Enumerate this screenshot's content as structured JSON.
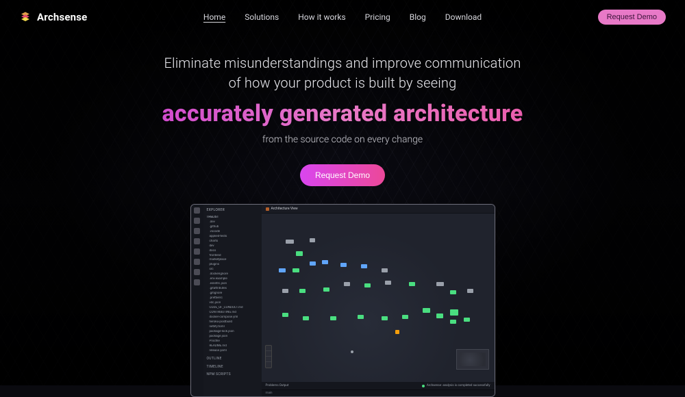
{
  "brand": {
    "name": "Archsense"
  },
  "nav": {
    "links": [
      {
        "label": "Home",
        "active": true
      },
      {
        "label": "Solutions",
        "active": false
      },
      {
        "label": "How it works",
        "active": false
      },
      {
        "label": "Pricing",
        "active": false
      },
      {
        "label": "Blog",
        "active": false
      },
      {
        "label": "Download",
        "active": false
      }
    ],
    "cta": "Request Demo"
  },
  "hero": {
    "lead_line1": "Eliminate misunderstandings and improve communication",
    "lead_line2": "of how your product is built by seeing",
    "title": "accurately generated architecture",
    "sub": "from the source code on every change",
    "cta": "Request Demo"
  },
  "mock": {
    "explorer_title": "EXPLORER",
    "root": "THELIST",
    "tree": [
      ".dev",
      ".github",
      ".vscode",
      "applied-tests",
      "charts",
      "dev",
      "docs",
      "frontend",
      "marketplace",
      "plugins",
      "src",
      ".dockerignore",
      ".env.example",
      ".eslintrc.json",
      ".gitattributes",
      ".gitignore",
      ".prettierrc",
      "vdc.json",
      "CODE_OF_CONDUCT.md",
      "CONTRIBUTING.md",
      "docker-compose.yml",
      "heroku-postbuild",
      "netlify.toml",
      "package-lock.json",
      "package.json",
      "Procfile",
      "README.md",
      "release.yaml"
    ],
    "sections": {
      "outline": "OUTLINE",
      "timeline": "TIMELINE",
      "npm": "NPM SCRIPTS"
    },
    "tab": "Architecture View",
    "status_left": "Problems  Output",
    "status_right": "Archsense: analysis is completed successfully",
    "bottom": "main"
  }
}
